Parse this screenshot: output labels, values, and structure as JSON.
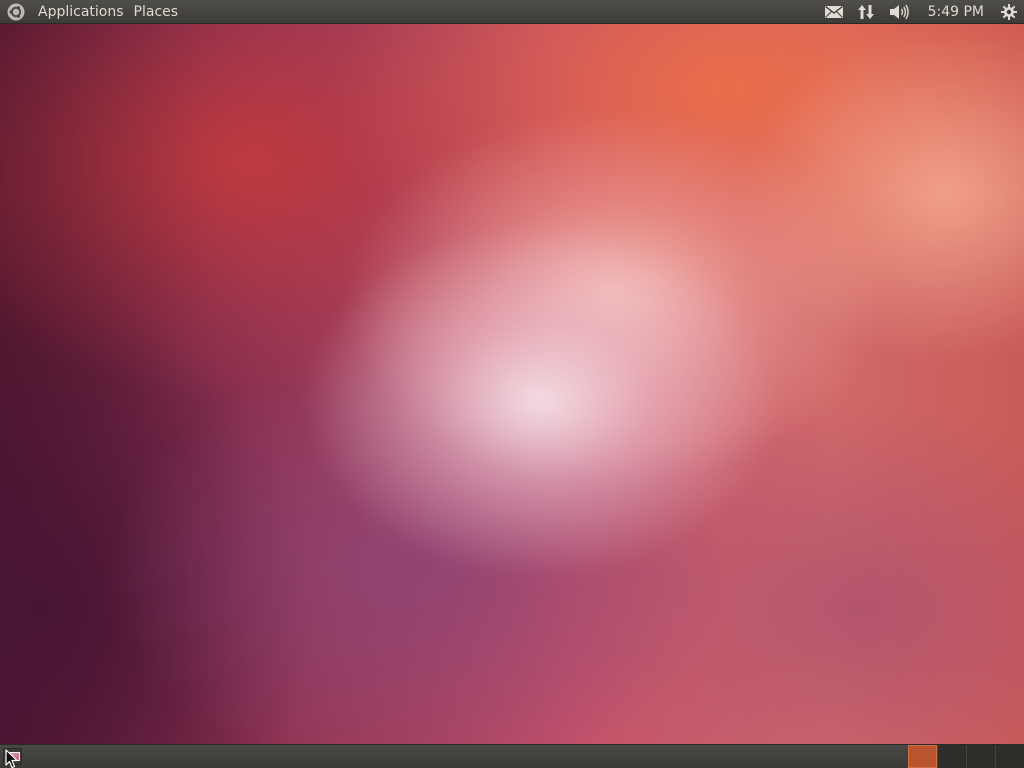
{
  "top_panel": {
    "menus": {
      "applications": "Applications",
      "places": "Places"
    },
    "indicators": {
      "mail_icon": "envelope-icon",
      "network_icon": "network-arrows-icon",
      "sound_icon": "speaker-icon",
      "session_icon": "power-gear-icon"
    },
    "clock": "5:49 PM"
  },
  "bottom_panel": {
    "show_desktop_icon": "show-desktop-icon",
    "workspaces": [
      {
        "active": true
      },
      {
        "active": false
      },
      {
        "active": false
      },
      {
        "active": false
      }
    ]
  },
  "colors": {
    "panel": "#3c3b37",
    "panel_text": "#dfdbd2",
    "workspace_active": "#b9552e"
  }
}
